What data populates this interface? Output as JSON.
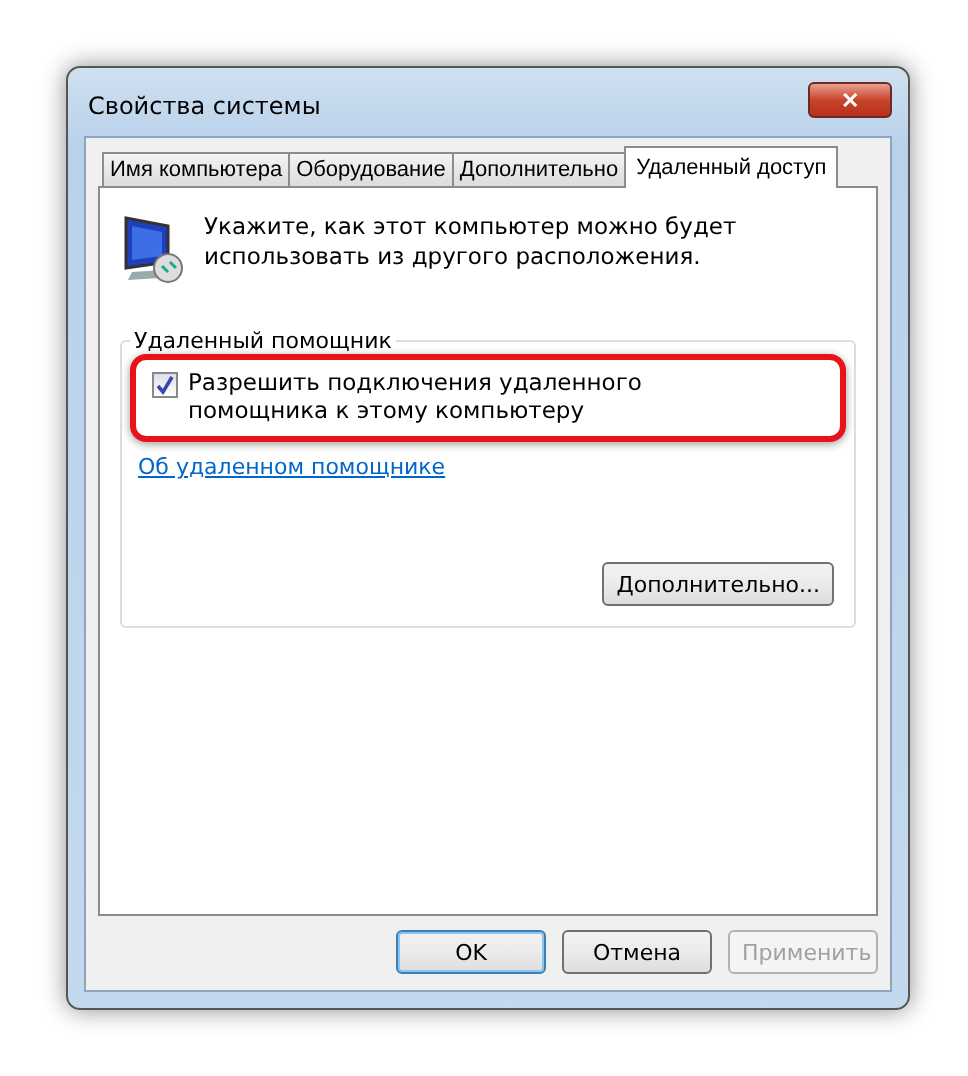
{
  "window": {
    "title": "Свойства системы",
    "close_label": "✕"
  },
  "tabs": [
    {
      "label": "Имя компьютера",
      "selected": false
    },
    {
      "label": "Оборудование",
      "selected": false
    },
    {
      "label": "Дополнительно",
      "selected": false
    },
    {
      "label": "Удаленный доступ",
      "selected": true
    }
  ],
  "intro": "Укажите, как этот компьютер можно будет использовать из другого расположения.",
  "group": {
    "title": "Удаленный помощник",
    "checkbox": {
      "label": "Разрешить подключения удаленного помощника к этому компьютеру",
      "checked": true,
      "highlighted": true
    },
    "link": "Об удаленном помощнике",
    "button": "Дополнительно..."
  },
  "buttons": [
    {
      "label": "OK",
      "default": true,
      "disabled": false
    },
    {
      "label": "Отмена",
      "default": false,
      "disabled": false
    },
    {
      "label": "Применить",
      "default": false,
      "disabled": true
    }
  ]
}
